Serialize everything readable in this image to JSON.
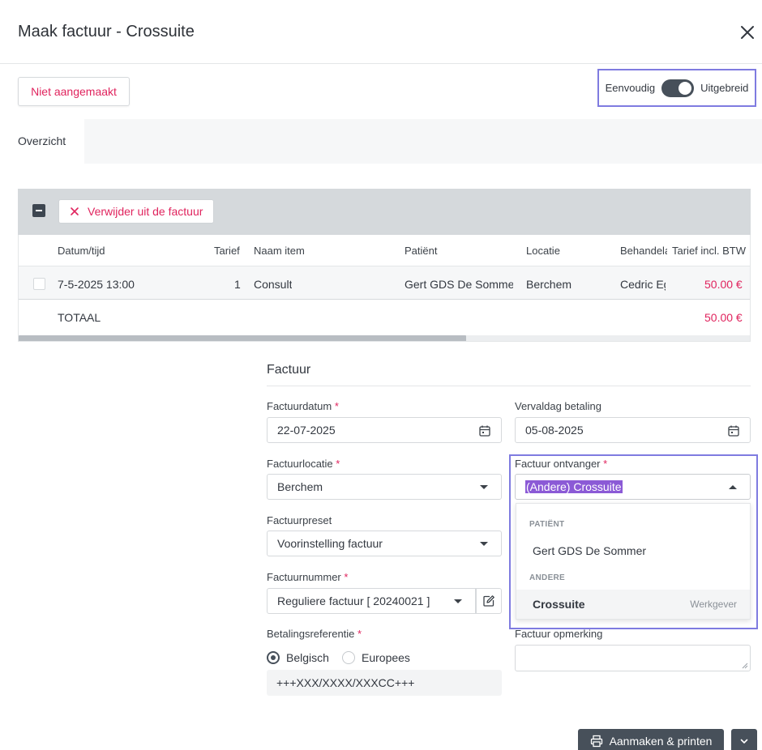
{
  "header": {
    "title": "Maak factuur - Crossuite",
    "close_icon": "close-icon"
  },
  "status": {
    "label": "Niet aangemaakt"
  },
  "mode": {
    "left_label": "Eenvoudig",
    "right_label": "Uitgebreid",
    "enabled": true
  },
  "overview": {
    "label": "Overzicht"
  },
  "table": {
    "remove_label": "Verwijder uit de factuur",
    "columns": [
      "Datum/tijd",
      "Tarief",
      "Naam item",
      "Patiënt",
      "Locatie",
      "Behandelaar",
      "Tarief incl. BTW"
    ],
    "rows": [
      {
        "date": "7-5-2025 13:00",
        "qty": "1",
        "item": "Consult",
        "patient": "Gert GDS De Sommer",
        "location": "Berchem",
        "practitioner": "Cedric Eg",
        "price": "50.00 €"
      }
    ],
    "total_label": "TOTAAL",
    "total_value": "50.00 €"
  },
  "form": {
    "section_title": "Factuur",
    "invoice_date": {
      "label": "Factuurdatum",
      "value": "22-07-2025"
    },
    "due_date": {
      "label": "Vervaldag betaling",
      "value": "05-08-2025"
    },
    "location": {
      "label": "Factuurlocatie",
      "value": "Berchem"
    },
    "recipient": {
      "label": "Factuur ontvanger",
      "value": "(Andere) Crossuite"
    },
    "preset": {
      "label": "Factuurpreset",
      "value": "Voorinstelling factuur"
    },
    "number": {
      "label": "Factuurnummer",
      "value": "Reguliere factuur [ 20240021 ]"
    },
    "payment_ref": {
      "label": "Betalingsreferentie",
      "options": [
        "Belgisch",
        "Europees"
      ],
      "selected": "Belgisch",
      "value": "+++XXX/XXXX/XXXCC+++"
    },
    "remark": {
      "label": "Factuur opmerking",
      "value": ""
    }
  },
  "dropdown": {
    "groups": [
      {
        "title": "PATIËNT",
        "items": [
          {
            "label": "Gert GDS De Sommer",
            "tag": ""
          }
        ]
      },
      {
        "title": "ANDERE",
        "items": [
          {
            "label": "Crossuite",
            "tag": "Werkgever"
          }
        ]
      }
    ]
  },
  "footer": {
    "print_label": "Aanmaken & printen"
  },
  "colors": {
    "accent": "#e0245e",
    "dark": "#47505a",
    "highlight": "#7f7be0",
    "selection": "#8b5ad6"
  }
}
